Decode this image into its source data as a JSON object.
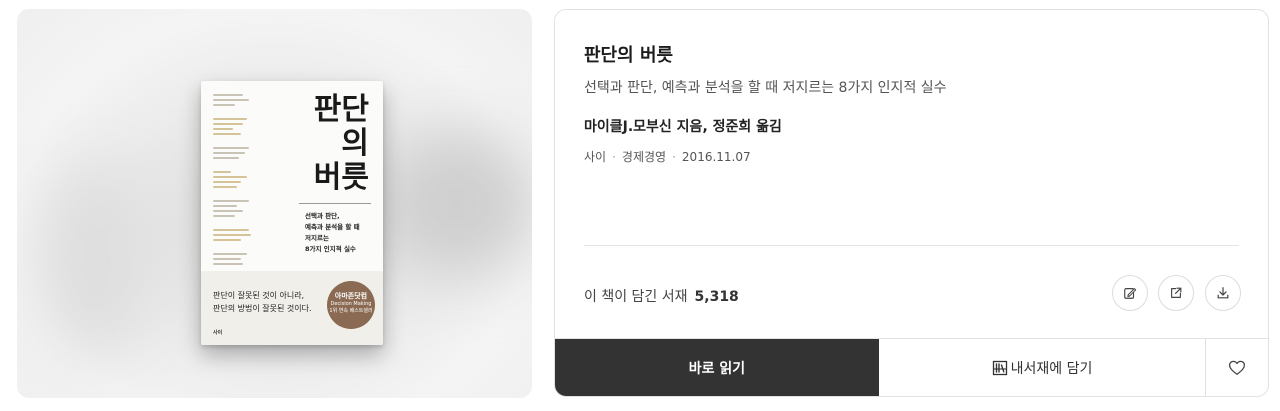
{
  "cover": {
    "title": "판단\n의\n버릇",
    "subtitle": "선택과 판단,\n예측과 분석을 할 때\n저지르는\n8가지 인지적 실수",
    "quote": "판단이 잘못된 것이 아니라,\n판단의 방법이 잘못된 것이다.",
    "badge_title": "아마존닷컴",
    "badge_line1": "Decision Making",
    "badge_line2": "1위 연속 베스트셀러",
    "publisher": "사이"
  },
  "book": {
    "title": "판단의 버릇",
    "subtitle": "선택과 판단, 예측과 분석을 할 때 저지르는 8가지 인지적 실수",
    "authors": "마이클J.모부신 지음, 정준희 옮김",
    "publisher": "사이",
    "category": "경제경영",
    "date": "2016.11.07",
    "separator": "·"
  },
  "shelf": {
    "label": "이 책이 담긴 서재",
    "count": "5,318"
  },
  "icons": {
    "review": "edit-icon",
    "share": "share-icon",
    "download": "download-icon",
    "add_shelf": "library-icon",
    "like": "heart-icon"
  },
  "actions": {
    "read_label": "바로 읽기",
    "add_shelf_label": "내서재에 담기"
  },
  "colors": {
    "read_button_bg": "#333333",
    "cover_badge": "#8a6a52"
  }
}
